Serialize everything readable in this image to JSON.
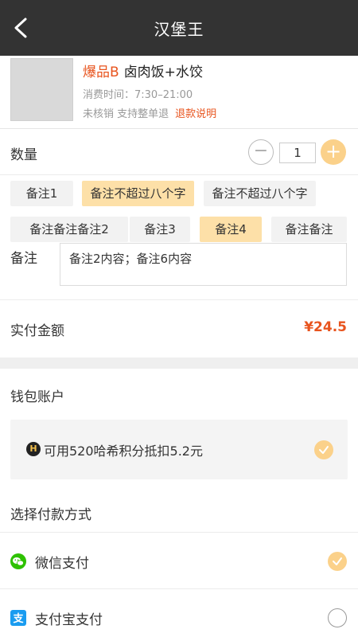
{
  "header": {
    "title": "汉堡王"
  },
  "product": {
    "hot_label": "爆品B",
    "name": "卤肉饭+水饺",
    "time": "消费时间：7:30–21:00",
    "policy": "未核销 支持整单退",
    "refund_link": "退款说明"
  },
  "quantity": {
    "label": "数量",
    "value": "1",
    "minus": "−",
    "plus": "+"
  },
  "tags": [
    {
      "label": "备注1",
      "selected": false
    },
    {
      "label": "备注不超过八个字",
      "selected": true
    },
    {
      "label": "备注不超过八个字",
      "selected": false
    },
    {
      "label": "备注备注备注2",
      "selected": false
    },
    {
      "label": "备注3",
      "selected": false
    },
    {
      "label": "备注4",
      "selected": true
    },
    {
      "label": "备注备注",
      "selected": false
    }
  ],
  "remark": {
    "label": "备注",
    "content": "备注2内容；备注6内容"
  },
  "payment": {
    "label": "实付金额",
    "amount": "¥24.5"
  },
  "wallet": {
    "title": "钱包账户",
    "points_text": "可用520哈希积分抵扣5.2元",
    "coin_icon": "H",
    "checked": true
  },
  "methods": {
    "title": "选择付款方式",
    "items": [
      {
        "label": "微信支付",
        "icon": "wechat-icon",
        "checked": true
      },
      {
        "label": "支付宝支付",
        "icon": "alipay-icon",
        "checked": false
      }
    ]
  },
  "colors": {
    "accent": "#e8541e",
    "topbar": "#333333",
    "selected": "#fde0a8",
    "check": "#fbd18a"
  }
}
